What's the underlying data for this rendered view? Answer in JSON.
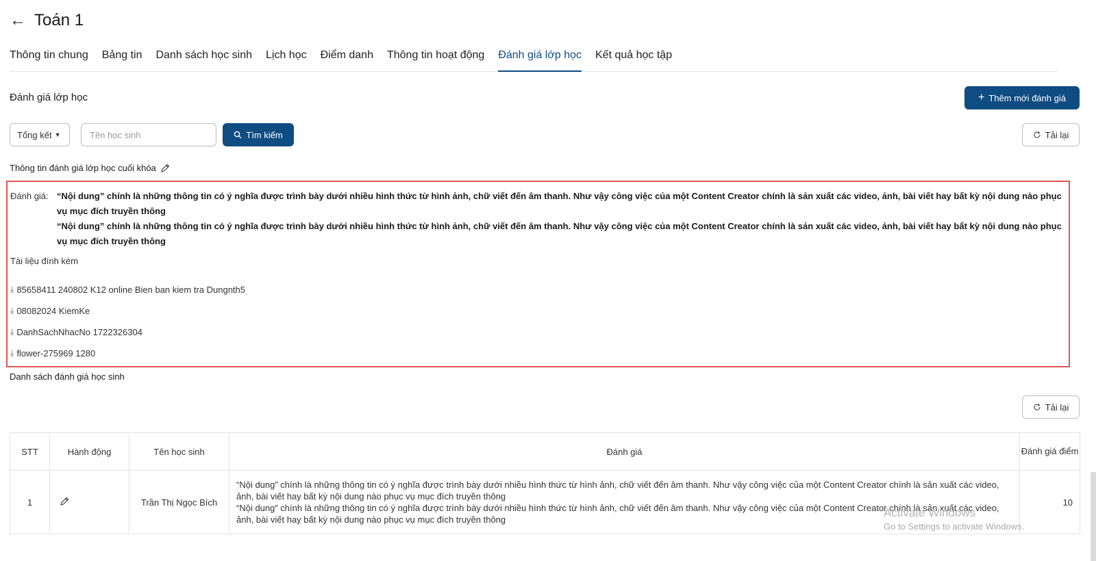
{
  "header": {
    "back_icon": "arrow-left-icon",
    "title": "Toán 1"
  },
  "tabs": [
    {
      "label": "Thông tin chung"
    },
    {
      "label": "Bảng tin"
    },
    {
      "label": "Danh sách học sinh"
    },
    {
      "label": "Lịch học"
    },
    {
      "label": "Điểm danh"
    },
    {
      "label": "Thông tin hoạt động"
    },
    {
      "label": "Đánh giá lớp học",
      "active": true
    },
    {
      "label": "Kết quả học tập"
    }
  ],
  "section": {
    "title": "Đánh giá lớp học",
    "add_button": "Thêm mới đánh giá"
  },
  "filters": {
    "select_value": "Tổng kết",
    "search_placeholder": "Tên học sinh",
    "search_button": "Tìm kiếm",
    "reload_button": "Tải lại"
  },
  "summary": {
    "heading": "Thông tin đánh giá lớp học cuối khóa",
    "eval_label": "Đánh giá:",
    "eval_paragraphs": [
      "“Nội dung” chính là những thông tin có ý nghĩa được trình bày dưới nhiều hình thức từ hình ảnh, chữ viết đến âm thanh. Như vậy công việc của một Content Creator chính là sản xuất các video, ảnh, bài viết hay bất kỳ nội dung nào phục vụ mục đích truyền thông",
      "“Nội dung” chính là những thông tin có ý nghĩa được trình bày dưới nhiều hình thức từ hình ảnh, chữ viết đến âm thanh. Như vậy công việc của một Content Creator chính là sản xuất các video, ảnh, bài viết hay bất kỳ nội dung nào phục vụ mục đích truyền thông"
    ],
    "attachments_label": "Tài liệu đính kèm",
    "attachments": [
      "85658411 240802 K12 online Bien ban kiem tra Dungnth5",
      "08082024 KiemKe",
      "DanhSachNhacNo 1722326304",
      "flower-275969 1280"
    ]
  },
  "student_list": {
    "heading": "Danh sách đánh giá học sinh",
    "reload_button": "Tải lại",
    "columns": {
      "stt": "STT",
      "action": "Hành động",
      "name": "Tên học sinh",
      "evaluation": "Đánh giá",
      "score": "Đánh giá điểm"
    },
    "rows": [
      {
        "stt": "1",
        "name": "Trần Thị Ngọc Bích",
        "evaluation": "“Nội dung” chính là những thông tin có ý nghĩa được trình bày dưới nhiều hình thức từ hình ảnh, chữ viết đến âm thanh. Như vậy công việc của một Content Creator chính là sản xuất các video, ảnh, bài viết hay bất kỳ nội dung nào phục vụ mục đích truyền thông\n“Nội dung” chính là những thông tin có ý nghĩa được trình bày dưới nhiều hình thức từ hình ảnh, chữ viết đến âm thanh. Như vậy công việc của một Content Creator chính là sản xuất các video, ảnh, bài viết hay bất kỳ nội dung nào phục vụ mục đích truyền thông",
        "score": "10"
      }
    ]
  },
  "watermark": {
    "line1": "Activate Windows",
    "line2": "Go to Settings to activate Windows."
  },
  "colors": {
    "primary": "#0f4c81",
    "highlight_border": "#e05656"
  }
}
